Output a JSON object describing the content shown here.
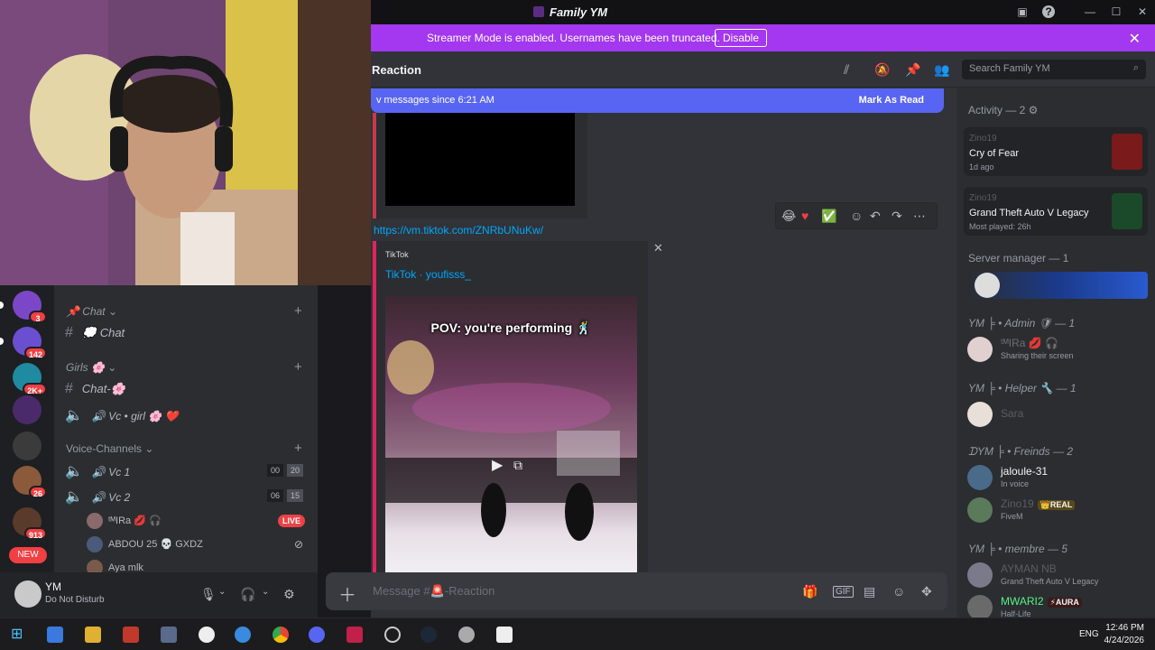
{
  "window": {
    "title": "Family YM"
  },
  "banner": {
    "message": "Streamer Mode is enabled. Usernames have been truncated.",
    "button": "Disable"
  },
  "servers": [
    {
      "badge": "3",
      "color": "#7b47c8"
    },
    {
      "badge": "142",
      "color": "#6a4fd1"
    },
    {
      "badge": "2K+",
      "color": "#1f8aa0"
    },
    {
      "badge": "",
      "color": "#4a2a6a"
    },
    {
      "badge": "",
      "color": "#3b3b3b"
    },
    {
      "badge": "26",
      "color": "#8a5a3a"
    },
    {
      "badge": "913",
      "color": "#5a3a2a"
    }
  ],
  "rail": {
    "new_label": "NEW"
  },
  "channels": {
    "cat_chat": "📌 Chat ⌄",
    "chat": "💭 Chat",
    "cat_girls": "Girls 🌸 ⌄",
    "chat_girls": "Chat-🌸",
    "vc_girl": "🔊 Vc • girl 🌸 ❤️",
    "cat_voice": "Voice-Channels ⌄",
    "vc1": "🔊 Vc 1",
    "vc1_counts": [
      "00",
      "20"
    ],
    "vc2": "🔊 Vc 2",
    "vc2_counts": [
      "06",
      "15"
    ],
    "voice_users": [
      {
        "name": "ᵗᴹIRa",
        "extra": "💋 🎧",
        "live": "LIVE"
      },
      {
        "name": "ABDOU 25",
        "extra": "💀 GXDZ",
        "live": ""
      },
      {
        "name": "Aya mlk",
        "extra": "",
        "live": ""
      }
    ]
  },
  "user": {
    "name": "YM",
    "status": "Do Not Disturb"
  },
  "chat": {
    "channel_name": "Reaction",
    "search_placeholder": "Search Family YM",
    "new_messages": "v messages since 6:21 AM",
    "mark_as_read": "Mark As Read",
    "link": "https://vm.tiktok.com/ZNRbUNuKw/",
    "embed_provider": "TikTok",
    "embed_author": "TikTok · youfisss_",
    "video_caption": "POV: you're performing 🕺",
    "composer_placeholder": "Message #🚨-Reaction"
  },
  "members": {
    "activity_header": "Activity — 2 ⚙",
    "activities": [
      {
        "user": "Zino19",
        "game": "Cry of Fear",
        "time": "1d ago"
      },
      {
        "user": "Zino19",
        "game": "Grand Theft Auto V Legacy",
        "time": "Most played: 26h"
      }
    ],
    "server_manager": "Server manager — 1",
    "admin_header": "YM ╞ • Admin 🛡 — 1",
    "admin": {
      "name": "ᵗᴹIRa 💋 🎧",
      "sub": "Sharing their screen"
    },
    "helper_header": "YM ╞ • Helper 🔧 — 1",
    "helper": {
      "name": "Sara"
    },
    "friends_header": "ᗪYM ╞ • Freinds — 2",
    "friends": [
      {
        "name": "jaloule-31",
        "sub": "In voice",
        "tag": ""
      },
      {
        "name": "Zino19",
        "sub": "FiveM",
        "tag": "👑REAL"
      }
    ],
    "membre_header": "YM ╞ • membre — 5",
    "membres": [
      {
        "name": "AYMAN NB",
        "sub": "Grand Theft Auto V Legacy",
        "tag": ""
      },
      {
        "name": "MWARI2",
        "sub": "Half-Life",
        "tag": "⚡AURA"
      }
    ]
  },
  "taskbar": {
    "lang": "ENG",
    "time": "12:46 PM",
    "date": "4/24/2026"
  }
}
